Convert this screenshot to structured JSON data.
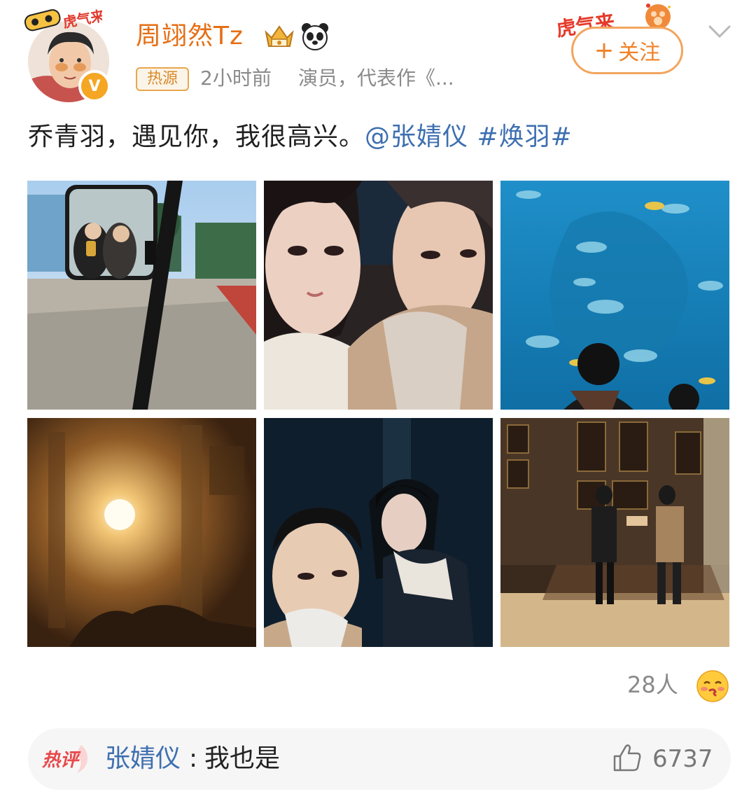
{
  "header": {
    "username": "周翊然Tz",
    "source_tag": "热源",
    "time": "2小时前",
    "description": "演员，代表作《...",
    "follow_label": "关注",
    "follow_plus": "+",
    "avatar_frame_text": "虎气来了",
    "verified_mark": "V",
    "tiger_deco_text": "虎气来"
  },
  "post": {
    "text": "乔青羽，遇见你，我很高兴。",
    "mention": "@张婧仪",
    "hashtag": "#焕羽#",
    "images": [
      {
        "name": "car-mirror-selfie"
      },
      {
        "name": "couple-selfie-closeup"
      },
      {
        "name": "aquarium-fish"
      },
      {
        "name": "warm-light-interior"
      },
      {
        "name": "night-couple-photo"
      },
      {
        "name": "gallery-hall-scene"
      }
    ]
  },
  "likes": {
    "count": "28人",
    "emoji": "kiss-emoji"
  },
  "hot_comment": {
    "badge": "热评",
    "author": "张婧仪",
    "separator": ":",
    "text": "我也是",
    "like_count": "6737"
  },
  "colors": {
    "username": "#e66e14",
    "link": "#3e6fb0",
    "follow_border": "#f3a55e",
    "hot_badge": "#e8484a"
  }
}
